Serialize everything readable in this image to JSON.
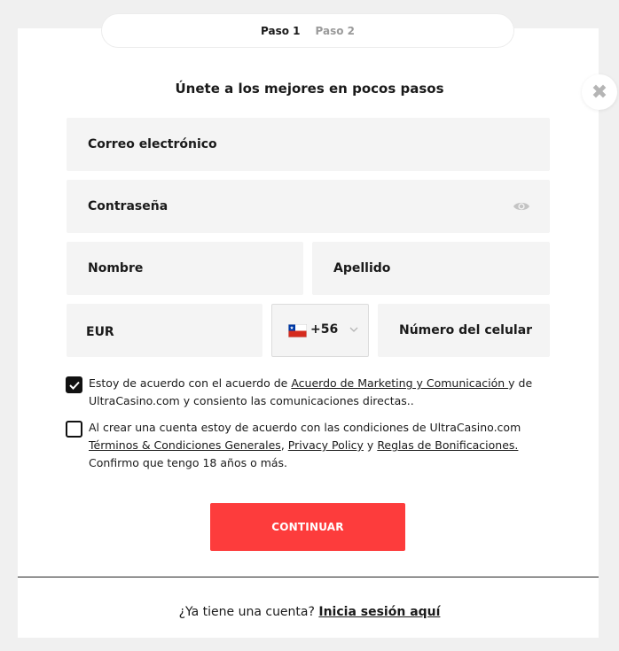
{
  "steps": {
    "step1": "Paso 1",
    "step2": "Paso 2"
  },
  "title": "Únete a los mejores en pocos pasos",
  "form": {
    "email_label": "Correo electrónico",
    "password_label": "Contraseña",
    "first_name_label": "Nombre",
    "last_name_label": "Apellido",
    "currency_value": "EUR",
    "phone_code": "+56",
    "phone_label": "Número del celular"
  },
  "consents": {
    "marketing": {
      "checked": true,
      "text_before": "Estoy de acuerdo con el acuerdo de ",
      "link": "Acuerdo de Marketing y Comunicación ",
      "text_after": "y de UltraCasino.com y consiento las comunicaciones directas.."
    },
    "terms": {
      "checked": false,
      "text_before": "Al crear una cuenta estoy de acuerdo con las condiciones de UltraCasino.com ",
      "link1": "Términos & Condiciones Generales",
      "sep1": ", ",
      "link2": "Privacy Policy",
      "sep2": " y ",
      "link3": "Reglas de Bonificaciones.",
      "text_after": " Confirmo que tengo 18 años o más."
    }
  },
  "continue_label": "CONTINUAR",
  "footer": {
    "question": "¿Ya tiene una cuenta? ",
    "login_link": "Inicia sesión aquí"
  },
  "colors": {
    "accent": "#fd3c3c",
    "field_bg": "#f4f4f4",
    "page_bg": "#f0f0f0"
  },
  "icons": {
    "close": "close-icon",
    "eye": "eye-icon",
    "flag": "chile-flag-icon",
    "chevron": "chevron-down-icon",
    "check": "checkmark-icon"
  }
}
